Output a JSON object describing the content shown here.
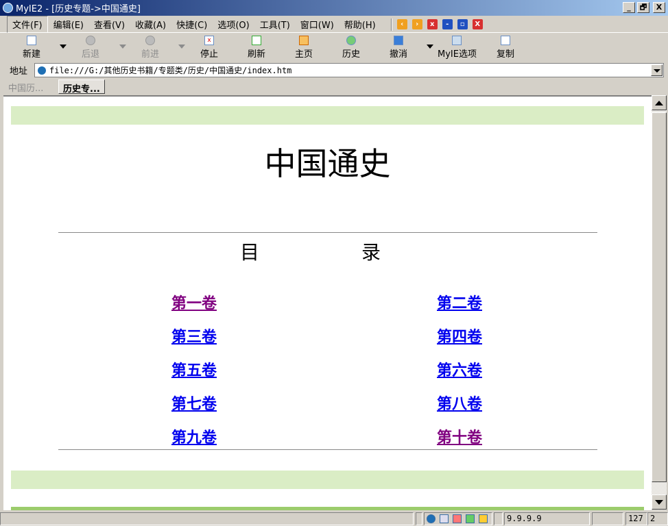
{
  "window": {
    "title": "MyIE2 - [历史专题->中国通史]",
    "buttons": [
      "_",
      "🗗",
      "X"
    ]
  },
  "menu": {
    "items": [
      "文件(F)",
      "编辑(E)",
      "查看(V)",
      "收藏(A)",
      "快捷(C)",
      "选项(O)",
      "工具(T)",
      "窗口(W)",
      "帮助(H)"
    ]
  },
  "toolbar": {
    "new": "新建",
    "back": "后退",
    "forward": "前进",
    "stop": "停止",
    "refresh": "刷新",
    "home": "主页",
    "history": "历史",
    "undo": "撤消",
    "options": "MyIE选项",
    "copy": "复制"
  },
  "address": {
    "label": "地址",
    "value": "file:///G:/其他历史书籍/专题类/历史/中国通史/index.htm"
  },
  "tabs": [
    {
      "label": "中国历...",
      "active": false
    },
    {
      "label": "历史专...",
      "active": true
    }
  ],
  "page": {
    "title": "中国通史",
    "toc": "目 录",
    "links": [
      {
        "label": "第一卷",
        "visited": true
      },
      {
        "label": "第二卷",
        "visited": false
      },
      {
        "label": "第三卷",
        "visited": false
      },
      {
        "label": "第四卷",
        "visited": false
      },
      {
        "label": "第五卷",
        "visited": false
      },
      {
        "label": "第六卷",
        "visited": false
      },
      {
        "label": "第七卷",
        "visited": false
      },
      {
        "label": "第八卷",
        "visited": false
      },
      {
        "label": "第九卷",
        "visited": false
      },
      {
        "label": "第十卷",
        "visited": true
      }
    ]
  },
  "status": {
    "ip": "9.9.9.9",
    "count": "127",
    "num": "2"
  },
  "colors": {
    "band": "#daedc5",
    "link": "#0000ee",
    "visited": "#800080"
  }
}
